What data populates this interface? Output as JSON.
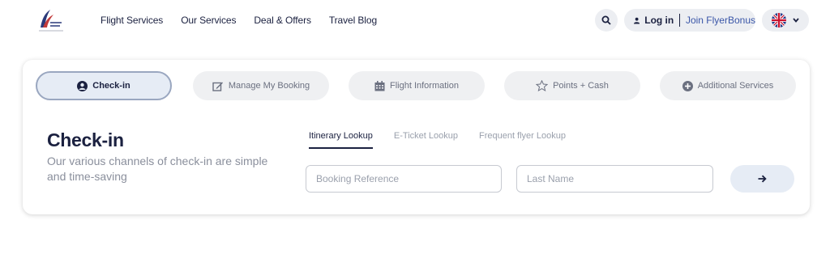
{
  "header": {
    "brand_color": "#1b2140",
    "nav": [
      {
        "label": "Flight Services"
      },
      {
        "label": "Our Services"
      },
      {
        "label": "Deal & Offers"
      },
      {
        "label": "Travel Blog"
      }
    ],
    "search_icon": "search-icon",
    "login_label": "Log in",
    "join_label": "Join FlyerBonus",
    "language_icon": "uk-flag-icon"
  },
  "booking_tabs": [
    {
      "label": "Check-in",
      "icon": "user-circle-icon",
      "active": true
    },
    {
      "label": "Manage My Booking",
      "icon": "edit-icon",
      "active": false
    },
    {
      "label": "Flight Information",
      "icon": "calendar-icon",
      "active": false
    },
    {
      "label": "Points + Cash",
      "icon": "star-icon",
      "active": false
    },
    {
      "label": "Additional Services",
      "icon": "plus-circle-icon",
      "active": false
    }
  ],
  "checkin": {
    "title": "Check-in",
    "subtitle": "Our various channels of check-in are simple and time-saving",
    "lookup_tabs": [
      {
        "label": "Itinerary Lookup",
        "active": true
      },
      {
        "label": "E-Ticket Lookup",
        "active": false
      },
      {
        "label": "Frequent flyer Lookup",
        "active": false
      }
    ],
    "booking_reference_placeholder": "Booking Reference",
    "last_name_placeholder": "Last Name",
    "submit_icon": "arrow-right-icon"
  }
}
